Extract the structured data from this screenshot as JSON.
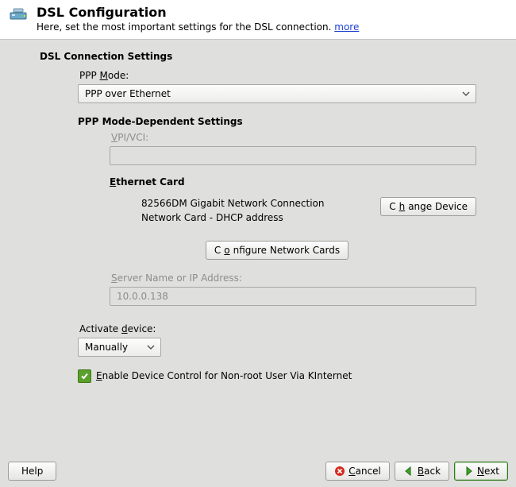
{
  "header": {
    "title": "DSL Configuration",
    "subtitle_prefix": "Here, set the most important settings for the DSL connection. ",
    "more_label": "more"
  },
  "section_title": "DSL Connection Settings",
  "ppp_mode": {
    "label_pre": "PPP ",
    "label_u": "M",
    "label_post": "ode:",
    "value": "PPP over Ethernet"
  },
  "ppp_dep": {
    "title": "PPP Mode-Dependent Settings",
    "vpi_label_pre": "",
    "vpi_label_u": "V",
    "vpi_label_post": "PI/VCI:",
    "vpi_value": ""
  },
  "ethernet": {
    "title_pre": "",
    "title_u": "E",
    "title_post": "thernet Card",
    "line1": "82566DM Gigabit Network Connection",
    "line2": "Network Card - DHCP address",
    "change_pre": "C",
    "change_u": "h",
    "change_post": "ange Device",
    "configure_pre": "C",
    "configure_u": "o",
    "configure_post": "nfigure Network Cards"
  },
  "server": {
    "label_pre": "",
    "label_u": "S",
    "label_post": "erver Name or IP Address:",
    "value": "10.0.0.138"
  },
  "activate": {
    "label_pre": "Activate ",
    "label_u": "d",
    "label_post": "evice:",
    "value": "Manually"
  },
  "kinternet": {
    "label_pre": "",
    "label_u": "E",
    "label_post": "nable Device Control for Non-root User Via KInternet",
    "checked": true
  },
  "buttons": {
    "help": "Help",
    "cancel_pre": "",
    "cancel_u": "C",
    "cancel_post": "ancel",
    "back_pre": "",
    "back_u": "B",
    "back_post": "ack",
    "next_pre": "",
    "next_u": "N",
    "next_post": "ext"
  }
}
